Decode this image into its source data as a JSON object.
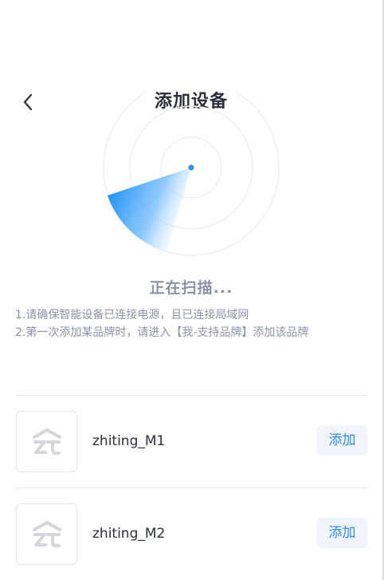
{
  "header": {
    "back_icon": "chevron-left-icon",
    "title": "添加设备"
  },
  "scan": {
    "status": "正在扫描...",
    "accent_color": "#2f8cf0"
  },
  "tips": [
    "1.请确保智能设备已连接电源，且已连接局域网",
    "2.第一次添加某品牌时，请进入【我-支持品牌】添加该品牌"
  ],
  "devices": [
    {
      "name": "zhiting_M1",
      "logo_icon": "zhiting-logo-icon",
      "add_label": "添加"
    },
    {
      "name": "zhiting_M2",
      "logo_icon": "zhiting-logo-icon",
      "add_label": "添加"
    }
  ]
}
